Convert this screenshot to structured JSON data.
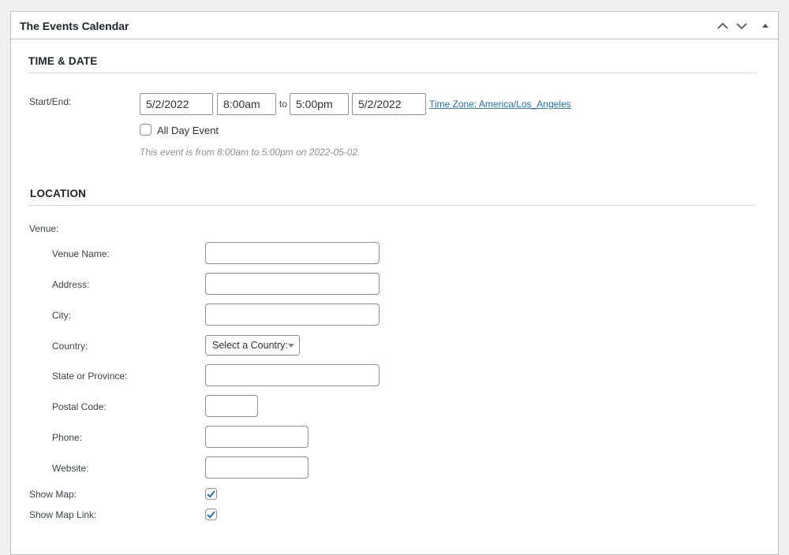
{
  "panel": {
    "title": "The Events Calendar",
    "controls": [
      "chevron-up-icon",
      "chevron-down-icon",
      "triangle-up-icon"
    ]
  },
  "time_date": {
    "heading": "TIME & DATE",
    "start_end_label": "Start/End:",
    "start_date": "5/2/2022",
    "start_time": "8:00am",
    "to_label": "to",
    "end_time": "5:00pm",
    "end_date": "5/2/2022",
    "timezone_link": "Time Zone: America/Los_Angeles",
    "all_day_label": "All Day Event",
    "all_day_checked": false,
    "summary": "This event is from 8:00am to 5:00pm on 2022-05-02."
  },
  "location": {
    "heading": "LOCATION",
    "venue_label": "Venue:",
    "venue_name_label": "Venue Name:",
    "address_label": "Address:",
    "city_label": "City:",
    "country_label": "Country:",
    "country_select": "Select a Country:",
    "state_label": "State or Province:",
    "postal_label": "Postal Code:",
    "phone_label": "Phone:",
    "website_label": "Website:",
    "show_map_label": "Show Map:",
    "show_map_checked": true,
    "show_map_link_label": "Show Map Link:",
    "show_map_link_checked": true
  },
  "colors": {
    "accent": "#2271b1",
    "border": "#8c8f94",
    "background": "#f0f0f1"
  }
}
